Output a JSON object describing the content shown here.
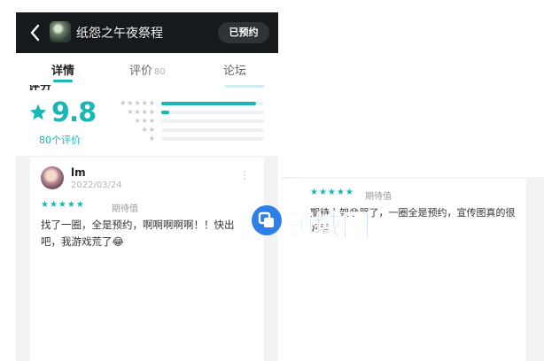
{
  "header": {
    "title": "纸怨之午夜祭程",
    "booked_label": "已预约"
  },
  "tabs": [
    {
      "label": "详情",
      "count": ""
    },
    {
      "label": "评价",
      "count": "80"
    },
    {
      "label": "论坛",
      "count": ""
    }
  ],
  "rating": {
    "score": "9.8",
    "count_label": "80个评价",
    "distribution": [
      {
        "stars": "★★★★★",
        "fraction": 0.92
      },
      {
        "stars": "★★★★",
        "fraction": 0.08
      },
      {
        "stars": "★★★",
        "fraction": 0.0
      },
      {
        "stars": "★★",
        "fraction": 0.0
      },
      {
        "stars": "★",
        "fraction": 0.0
      }
    ]
  },
  "review": {
    "user": "lm",
    "date": "2022/03/24",
    "stars": "★★★★★",
    "tag": "期待值",
    "text": "找了一圈，全是预约，啊啊啊啊啊！！快出吧，我游戏荒了😂"
  },
  "side_review": {
    "stars": "★★★★★",
    "tag": "期待值",
    "text": "期待上架😟哭了，一圈全是预约，宣传图真的很好看"
  },
  "watermark": {
    "text": "领域圈"
  },
  "colors": {
    "accent": "#18b6b5",
    "header_bg": "#161a1d",
    "watermark": "#2f7fe8"
  }
}
